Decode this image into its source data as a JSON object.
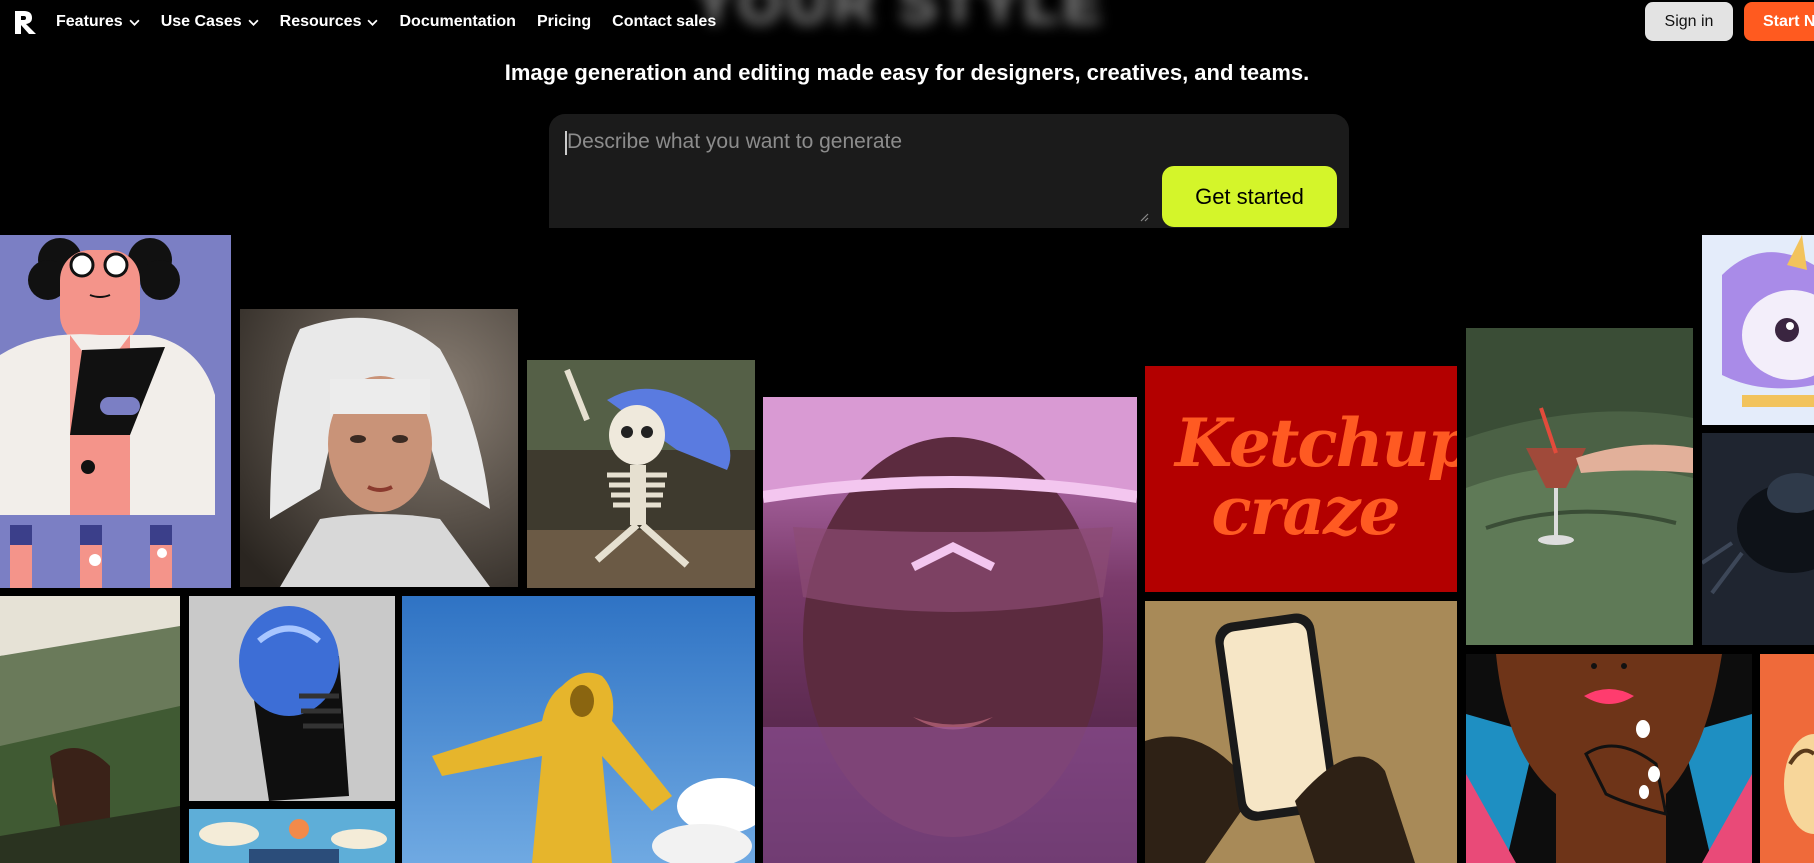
{
  "nav": {
    "logo_icon": "brand-logo-icon",
    "items": [
      {
        "label": "Features",
        "has_dropdown": true
      },
      {
        "label": "Use Cases",
        "has_dropdown": true
      },
      {
        "label": "Resources",
        "has_dropdown": true
      },
      {
        "label": "Documentation",
        "has_dropdown": false
      },
      {
        "label": "Pricing",
        "has_dropdown": false
      },
      {
        "label": "Contact sales",
        "has_dropdown": false
      }
    ],
    "sign_in_label": "Sign in",
    "start_label": "Start N"
  },
  "hero": {
    "blurred_title": "YOUR STYLE",
    "subtitle": "Image generation and editing made easy for designers, creatives, and teams.",
    "prompt_placeholder": "Describe what you want to generate",
    "prompt_value": "",
    "cta_label": "Get started"
  },
  "gallery": {
    "ketchup_text_line1": "Ketchup",
    "ketchup_text_line2": "craze"
  },
  "colors": {
    "background": "#000000",
    "accent_lime": "#d4f52a",
    "accent_orange": "#ff5a1f",
    "ketchup_red": "#b30000"
  }
}
